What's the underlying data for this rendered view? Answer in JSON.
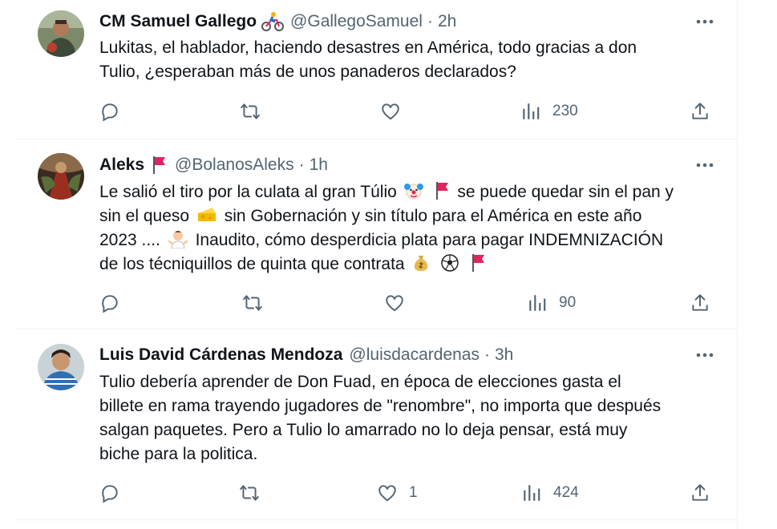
{
  "tweets": [
    {
      "name": "CM Samuel Gallego",
      "name_emoji_icon": "cyclist-emoji",
      "handle": "@GallegoSamuel",
      "separator": "·",
      "time": "2h",
      "lines": [
        "Lukitas, el hablador, haciendo desastres en América, todo gracias a don",
        "Tulio, ¿esperaban más de unos panaderos declarados?"
      ],
      "replies": "",
      "retweets": "",
      "likes": "",
      "views": "230"
    },
    {
      "name": "Aleks",
      "name_emoji_icon": "red-flag-emoji",
      "handle": "@BolanosAleks",
      "separator": "·",
      "time": "1h",
      "segments": {
        "l1a": "Le salió el tiro por la culata al gran Túlio",
        "l1b": "se puede quedar sin el pan y",
        "l2a": "sin el queso",
        "l2b": "sin Gobernación y sin título para el América en este año",
        "l3a": "2023 ....",
        "l3b": "Inaudito, cómo desperdicia plata para pagar INDEMNIZACIÓN",
        "l4a": "de los técniquillos de quinta que contrata"
      },
      "inline_icons": [
        "clown-face-emoji",
        "red-flag-emoji",
        "cheese-emoji",
        "person-shrugging-emoji",
        "money-bag-emoji",
        "soccer-ball-emoji",
        "red-flag-emoji"
      ],
      "replies": "",
      "retweets": "",
      "likes": "",
      "views": "90"
    },
    {
      "name": "Luis David Cárdenas Mendoza",
      "handle": "@luisdacardenas",
      "separator": "·",
      "time": "3h",
      "lines": [
        "Tulio debería aprender de Don Fuad, en época de elecciones gasta el",
        "billete en rama trayendo jugadores de \"renombre\", no importa que después",
        "salgan paquetes. Pero a Tulio lo amarrado no lo deja pensar, está muy",
        "biche para la politica."
      ],
      "replies": "",
      "retweets": "",
      "likes": "1",
      "views": "424"
    }
  ],
  "colors": {
    "text": "#0f1419",
    "secondary": "#536471",
    "divider": "#eff3f4",
    "flag": "#e0245e"
  },
  "action_icons": [
    "reply-icon",
    "retweet-icon",
    "like-icon",
    "views-icon",
    "share-icon"
  ]
}
